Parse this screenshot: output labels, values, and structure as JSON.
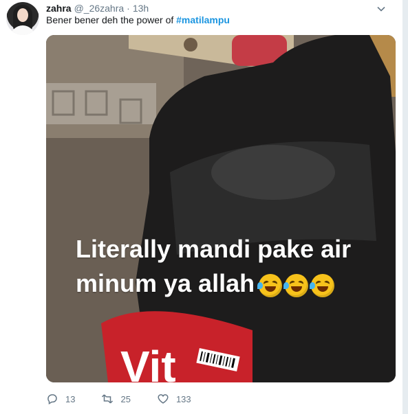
{
  "tweet": {
    "user": {
      "name": "zahra",
      "handle": "@_26zahra",
      "separator": "·",
      "time": "13h"
    },
    "text_prefix": "Bener bener deh the power of ",
    "hashtag": "#matilampu",
    "media": {
      "caption_line1": "Literally mandi pake air",
      "caption_line2": "minum ya allah",
      "bottle_label_text": "Vit"
    },
    "actions": {
      "reply_count": "13",
      "retweet_count": "25",
      "like_count": "133"
    }
  },
  "colors": {
    "primary_text": "#14171a",
    "secondary_text": "#657786",
    "link": "#1b95e0",
    "background": "#ffffff"
  },
  "icons": [
    "chevron-down-icon",
    "reply-icon",
    "retweet-icon",
    "heart-icon",
    "rofl-emoji-icon"
  ]
}
